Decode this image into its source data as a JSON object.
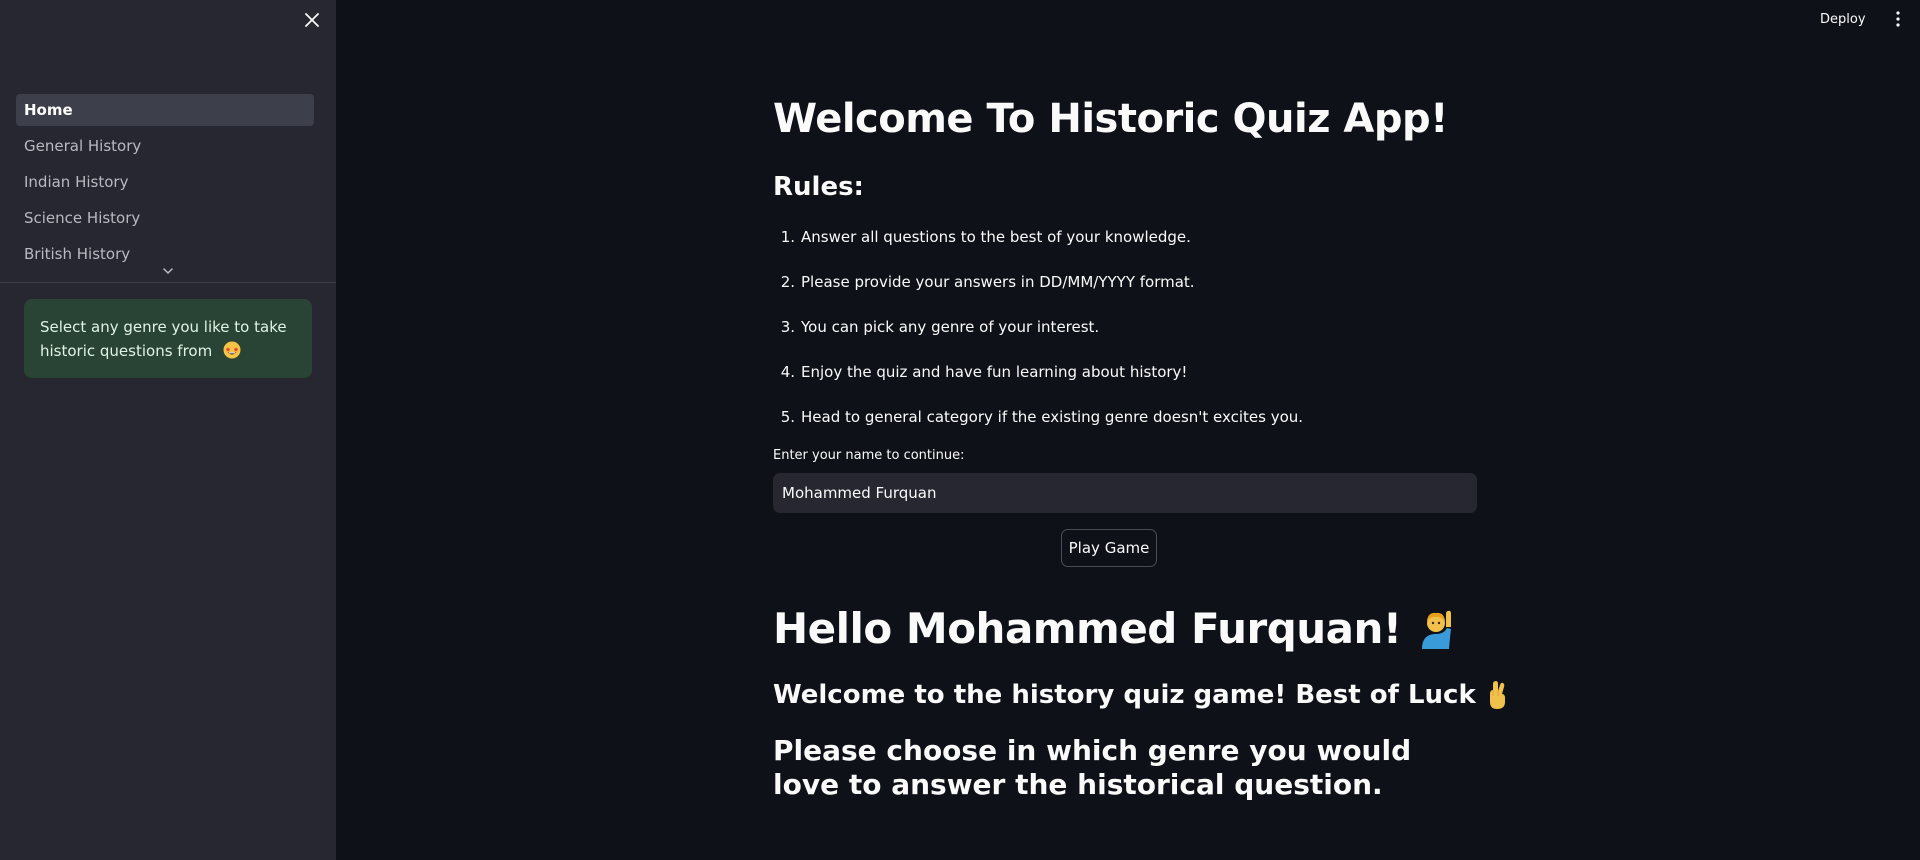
{
  "sidebar": {
    "nav_items": [
      {
        "label": "Home",
        "active": true
      },
      {
        "label": "General History",
        "active": false
      },
      {
        "label": "Indian History",
        "active": false
      },
      {
        "label": "Science History",
        "active": false
      },
      {
        "label": "British History",
        "active": false
      }
    ],
    "info_text": "Select any genre you like to take historic questions from",
    "info_emoji": "star-struck-icon"
  },
  "header": {
    "deploy_label": "Deploy"
  },
  "main": {
    "title": "Welcome To Historic Quiz App!",
    "rules_heading": "Rules:",
    "rules": [
      {
        "num": "1.",
        "text": "Answer all questions to the best of your knowledge."
      },
      {
        "num": "2.",
        "text": "Please provide your answers in DD/MM/YYYY format."
      },
      {
        "num": "3.",
        "text": "You can pick any genre of your interest."
      },
      {
        "num": "4.",
        "text": "Enjoy the quiz and have fun learning about history!"
      },
      {
        "num": "5.",
        "text": "Head to general category if the existing genre doesn't excites you."
      }
    ],
    "name_label": "Enter your name to continue:",
    "name_value": "Mohammed Furquan",
    "play_button": "Play Game",
    "hello_text": "Hello Mohammed Furquan!",
    "welcome_text": "Welcome to the history quiz game! Best of Luck",
    "choose_text": "Please choose in which genre you would love to answer the historical question."
  },
  "colors": {
    "background": "#0e1117",
    "sidebar": "#262730",
    "success_box": "#294434",
    "text": "#fafafa"
  }
}
